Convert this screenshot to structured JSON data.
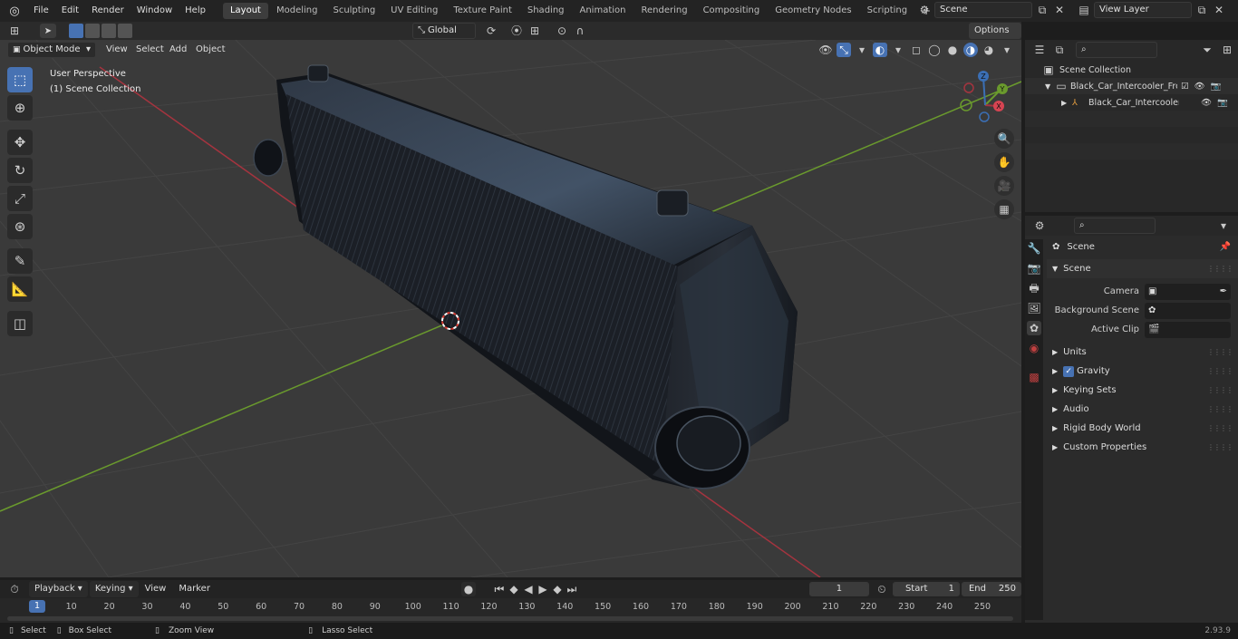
{
  "menu": [
    "File",
    "Edit",
    "Render",
    "Window",
    "Help"
  ],
  "workspaces": [
    "Layout",
    "Modeling",
    "Sculpting",
    "UV Editing",
    "Texture Paint",
    "Shading",
    "Animation",
    "Rendering",
    "Compositing",
    "Geometry Nodes",
    "Scripting"
  ],
  "active_workspace": "Layout",
  "scene_name": "Scene",
  "view_layer": "View Layer",
  "viewport": {
    "mode": "Object Mode",
    "menus": [
      "View",
      "Select",
      "Add",
      "Object"
    ],
    "transform_orientation": "Global",
    "options_label": "Options",
    "overlay_title": "User Perspective",
    "overlay_subtitle": "(1) Scene Collection",
    "gizmo": {
      "x": "X",
      "y": "Y",
      "z": "Z"
    }
  },
  "outliner": {
    "root": "Scene Collection",
    "collection": "Black_Car_Intercooler_Front_",
    "object": "Black_Car_Intercooler_Fr"
  },
  "properties": {
    "context": "Scene",
    "panel": "Scene",
    "fields": [
      {
        "label": "Camera",
        "value": ""
      },
      {
        "label": "Background Scene",
        "value": ""
      },
      {
        "label": "Active Clip",
        "value": ""
      }
    ],
    "subpanels": [
      "Units",
      "Gravity",
      "Keying Sets",
      "Audio",
      "Rigid Body World",
      "Custom Properties"
    ]
  },
  "timeline": {
    "menus": [
      "Playback",
      "Keying",
      "View",
      "Marker"
    ],
    "current_frame": "1",
    "start_label": "Start",
    "start": "1",
    "end_label": "End",
    "end": "250",
    "ruler": [
      "1",
      "10",
      "20",
      "30",
      "40",
      "50",
      "60",
      "70",
      "80",
      "90",
      "100",
      "110",
      "120",
      "130",
      "140",
      "150",
      "160",
      "170",
      "180",
      "190",
      "200",
      "210",
      "220",
      "230",
      "240",
      "250"
    ]
  },
  "status": {
    "select": "Select",
    "box_select": "Box Select",
    "zoom_view": "Zoom View",
    "lasso_select": "Lasso Select",
    "version": "2.93.9"
  }
}
